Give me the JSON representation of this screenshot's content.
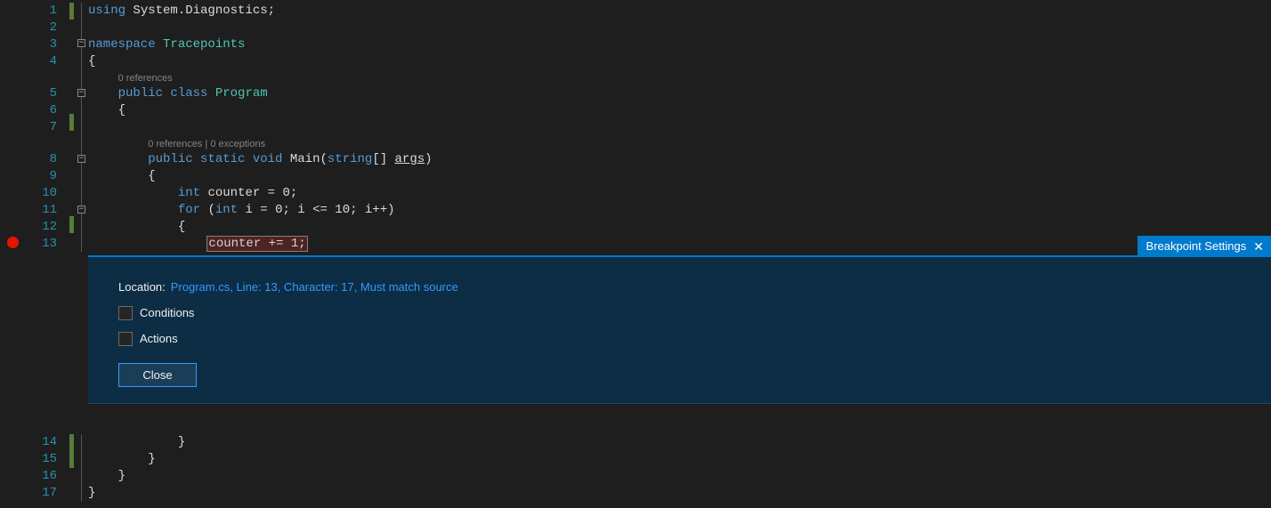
{
  "lines_top": [
    "1",
    "2",
    "3",
    "4",
    "5",
    "6",
    "7",
    "8",
    "9",
    "10",
    "11",
    "12",
    "13"
  ],
  "lines_bottom": [
    "14",
    "15",
    "16",
    "17"
  ],
  "code": {
    "l1_using": "using",
    "l1_ns": " System.Diagnostics;",
    "l3_ns_kw": "namespace",
    "l3_ns_name": " Tracepoints",
    "l4_brace": "{",
    "codelens1": "0 references",
    "l5_public": "public",
    "l5_class": " class",
    "l5_name": " Program",
    "l6_brace": "{",
    "codelens2": "0 references | 0 exceptions",
    "l8_public": "public",
    "l8_static": " static",
    "l8_void": " void",
    "l8_main": " Main(",
    "l8_string": "string",
    "l8_arr": "[] ",
    "l8_args": "args",
    "l8_close": ")",
    "l9_brace": "{",
    "l10_int": "int",
    "l10_rest": " counter = 0;",
    "l11_for": "for",
    "l11_open": " (",
    "l11_int": "int",
    "l11_rest": " i = 0; i <= 10; i++)",
    "l12_brace": "{",
    "l13_stmt": "counter += 1;",
    "l14_brace": "}",
    "l15_brace": "}",
    "l16_brace": "}",
    "l17_brace": "}"
  },
  "breakpoint_panel": {
    "tab_title": "Breakpoint Settings",
    "location_label": "Location:",
    "location_link": "Program.cs, Line: 13, Character: 17, Must match source",
    "conditions_label": "Conditions",
    "actions_label": "Actions",
    "close_label": "Close"
  }
}
